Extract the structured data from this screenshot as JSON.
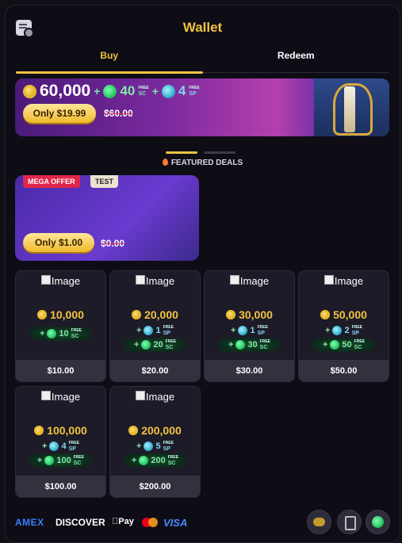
{
  "header": {
    "title": "Wallet",
    "menu_icon": "wallet-menu-icon"
  },
  "tabs": [
    {
      "label": "Buy",
      "active": true
    },
    {
      "label": "Redeem",
      "active": false
    }
  ],
  "hero": {
    "coins": "60,000",
    "sc_amount": "40",
    "sp_amount": "4",
    "free_label": "FREE",
    "sc_label": "SC",
    "sp_label": "SP",
    "price": "Only $19.99",
    "original_price": "$60.00"
  },
  "carousel": {
    "page_count": 2,
    "active_index": 0
  },
  "featured": {
    "label": "FEATURED DEALS"
  },
  "mega_offer": {
    "badge": "MEGA OFFER",
    "tag": "TEST",
    "price": "Only $1.00",
    "original_price": "$0.00"
  },
  "packages": [
    {
      "image_alt": "Image",
      "coins": "10,000",
      "sp": null,
      "sc": "10",
      "price": "$10.00"
    },
    {
      "image_alt": "Image",
      "coins": "20,000",
      "sp": "1",
      "sc": "20",
      "price": "$20.00"
    },
    {
      "image_alt": "Image",
      "coins": "30,000",
      "sp": "1",
      "sc": "30",
      "price": "$30.00"
    },
    {
      "image_alt": "Image",
      "coins": "50,000",
      "sp": "2",
      "sc": "50",
      "price": "$50.00"
    },
    {
      "image_alt": "Image",
      "coins": "100,000",
      "sp": "4",
      "sc": "100",
      "price": "$100.00"
    },
    {
      "image_alt": "Image",
      "coins": "200,000",
      "sp": "5",
      "sc": "200",
      "price": "$200.00"
    }
  ],
  "payment_methods": [
    "AMEX",
    "DISCOVER",
    "Pay",
    "mastercard",
    "VISA"
  ],
  "footer_buttons": [
    "chat-icon",
    "document-icon",
    "sweeps-coin-icon"
  ],
  "colors": {
    "accent": "#f2c341",
    "sc": "#7fe9a6",
    "sp": "#7fd9f0",
    "mega": "#e0264a"
  }
}
